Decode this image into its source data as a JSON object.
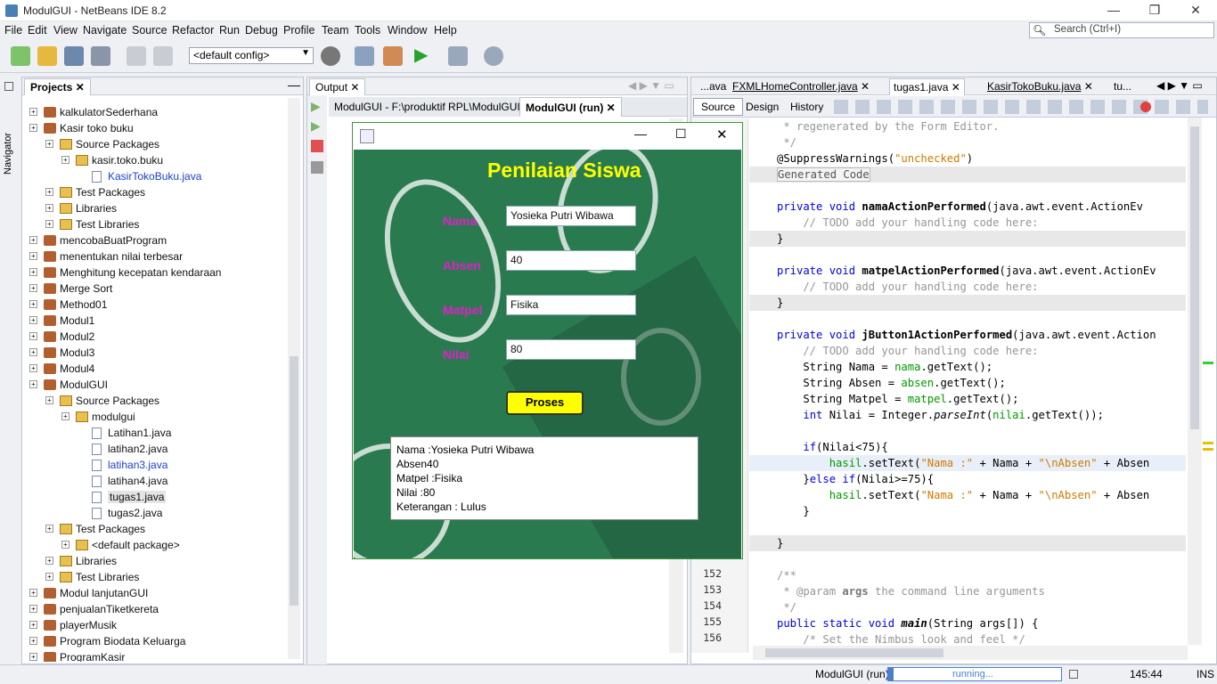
{
  "window": {
    "title": "ModulGUI - NetBeans IDE 8.2"
  },
  "menu": [
    "File",
    "Edit",
    "View",
    "Navigate",
    "Source",
    "Refactor",
    "Run",
    "Debug",
    "Profile",
    "Team",
    "Tools",
    "Window",
    "Help"
  ],
  "search": {
    "placeholder": "Search (Ctrl+I)"
  },
  "toolbar": {
    "config": "<default config>"
  },
  "navigator": {
    "label": "Navigator"
  },
  "projects": {
    "tab": "Projects",
    "items": [
      {
        "label": "kalkulatorSederhana",
        "type": "project",
        "indent": 0
      },
      {
        "label": "Kasir toko buku",
        "type": "project",
        "indent": 0
      },
      {
        "label": "Source Packages",
        "type": "folder",
        "indent": 1
      },
      {
        "label": "kasir.toko.buku",
        "type": "package",
        "indent": 2
      },
      {
        "label": "KasirTokoBuku.java",
        "type": "file",
        "indent": 3,
        "link": true
      },
      {
        "label": "Test Packages",
        "type": "folder",
        "indent": 1
      },
      {
        "label": "Libraries",
        "type": "folder",
        "indent": 1
      },
      {
        "label": "Test Libraries",
        "type": "folder",
        "indent": 1
      },
      {
        "label": "mencobaBuatProgram",
        "type": "project",
        "indent": 0
      },
      {
        "label": "menentukan nilai terbesar",
        "type": "project",
        "indent": 0
      },
      {
        "label": "Menghitung kecepatan kendaraan",
        "type": "project",
        "indent": 0
      },
      {
        "label": "Merge Sort",
        "type": "project",
        "indent": 0
      },
      {
        "label": "Method01",
        "type": "project",
        "indent": 0
      },
      {
        "label": "Modul1",
        "type": "project",
        "indent": 0
      },
      {
        "label": "Modul2",
        "type": "project",
        "indent": 0
      },
      {
        "label": "Modul3",
        "type": "project",
        "indent": 0
      },
      {
        "label": "Modul4",
        "type": "project",
        "indent": 0
      },
      {
        "label": "ModulGUI",
        "type": "project",
        "indent": 0
      },
      {
        "label": "Source Packages",
        "type": "folder",
        "indent": 1
      },
      {
        "label": "modulgui",
        "type": "package",
        "indent": 2
      },
      {
        "label": "Latihan1.java",
        "type": "file",
        "indent": 3
      },
      {
        "label": "latihan2.java",
        "type": "file",
        "indent": 3
      },
      {
        "label": "latihan3.java",
        "type": "file",
        "indent": 3,
        "link": true
      },
      {
        "label": "latihan4.java",
        "type": "file",
        "indent": 3
      },
      {
        "label": "tugas1.java",
        "type": "file",
        "indent": 3,
        "selected": true
      },
      {
        "label": "tugas2.java",
        "type": "file",
        "indent": 3
      },
      {
        "label": "Test Packages",
        "type": "folder",
        "indent": 1
      },
      {
        "label": "<default package>",
        "type": "package",
        "indent": 2
      },
      {
        "label": "Libraries",
        "type": "folder",
        "indent": 1
      },
      {
        "label": "Test Libraries",
        "type": "folder",
        "indent": 1
      },
      {
        "label": "Modul lanjutanGUI",
        "type": "project",
        "indent": 0
      },
      {
        "label": "penjualanTiketkereta",
        "type": "project",
        "indent": 0
      },
      {
        "label": "playerMusik",
        "type": "project",
        "indent": 0
      },
      {
        "label": "Program Biodata Keluarga",
        "type": "project",
        "indent": 0
      },
      {
        "label": "ProgramKasir",
        "type": "project",
        "indent": 0
      }
    ]
  },
  "output": {
    "tab": "Output",
    "subtabs": [
      "ModulGUI - F:\\produktif RPL\\ModulGUI",
      "ModulGUI (run)"
    ]
  },
  "editor": {
    "tabs": [
      "...ava",
      "FXMLHomeController.java",
      "tugas1.java",
      "KasirTokoBuku.java",
      "tu..."
    ],
    "source_btn": "Source",
    "design_btn": "Design",
    "history_btn": "History"
  },
  "code": [
    {
      "ln": "",
      "html": "<span class='cm'> * regenerated by the Form Editor.</span>"
    },
    {
      "ln": "",
      "html": "<span class='cm'> */</span>"
    },
    {
      "ln": "",
      "html": "@SuppressWarnings(<span class='st'>\"unchecked\"</span>)"
    },
    {
      "ln": "",
      "html": "<span style='border:1px solid #bbb;background:#f4f4f4;color:#555'>Generated Code</span>"
    },
    {
      "ln": "",
      "html": ""
    },
    {
      "ln": "",
      "html": "<span class='kw'>private void</span> <b>namaActionPerformed</b>(java.awt.event.ActionEv"
    },
    {
      "ln": "",
      "html": "<span class='cm'>    // TODO add your handling code here:</span>"
    },
    {
      "ln": "",
      "html": "}"
    },
    {
      "ln": "",
      "html": ""
    },
    {
      "ln": "",
      "html": "<span class='kw'>private void</span> <b>matpelActionPerformed</b>(java.awt.event.ActionEv"
    },
    {
      "ln": "",
      "html": "<span class='cm'>    // TODO add your handling code here:</span>"
    },
    {
      "ln": "",
      "html": "}"
    },
    {
      "ln": "",
      "html": ""
    },
    {
      "ln": "",
      "html": "<span class='kw'>private void</span> <b>jButton1ActionPerformed</b>(java.awt.event.Action"
    },
    {
      "ln": "",
      "html": "<span class='cm'>    // TODO add your handling code here:</span>"
    },
    {
      "ln": "",
      "html": "    String Nama = <span class='fld'>nama</span>.getText();"
    },
    {
      "ln": "",
      "html": "    String Absen = <span class='fld'>absen</span>.getText();"
    },
    {
      "ln": "",
      "html": "    String Matpel = <span class='fld'>matpel</span>.getText();"
    },
    {
      "ln": "",
      "html": "    <span class='kw'>int</span> Nilai = Integer.<i>parseInt</i>(<span class='fld'>nilai</span>.getText());"
    },
    {
      "ln": "",
      "html": ""
    },
    {
      "ln": "",
      "html": "    <span class='kw'>if</span>(Nilai&lt;75){"
    },
    {
      "ln": "",
      "html": "        <span class='fld'>hasil</span>.setText(<span class='st'>\"Nama :\"</span> + Nama + <span class='st'>\"\\nAbsen\"</span> + Absen"
    },
    {
      "ln": "",
      "html": "    }<span class='kw'>else if</span>(Nilai&gt;=75){"
    },
    {
      "ln": "",
      "html": "        <span class='fld'>hasil</span>.setText(<span class='st'>\"Nama :\"</span> + Nama + <span class='st'>\"\\nAbsen\"</span> + Absen"
    },
    {
      "ln": "",
      "html": "    }"
    },
    {
      "ln": "",
      "html": ""
    },
    {
      "ln": "",
      "html": "}"
    },
    {
      "ln": "",
      "html": ""
    },
    {
      "ln": "152",
      "html": "<span class='cm'>/**</span>"
    },
    {
      "ln": "153",
      "html": "<span class='cm'> * @param <b style='color:#777'>args</b> the command line arguments</span>"
    },
    {
      "ln": "154",
      "html": "<span class='cm'> */</span>"
    },
    {
      "ln": "155",
      "html": "<span class='kw'>public static void</span> <b><i>main</i></b>(String args[]) {"
    },
    {
      "ln": "156",
      "html": "<span class='cm'>    /* Set the Nimbus look and feel */</span>"
    }
  ],
  "app": {
    "heading": "Penilaian Siswa",
    "labels": {
      "nama": "Nama",
      "absen": "Absen",
      "matpel": "Matpel",
      "nilai": "Nilai"
    },
    "values": {
      "nama": "Yosieka Putri Wibawa",
      "absen": "40",
      "matpel": "Fisika",
      "nilai": "80"
    },
    "button": "Proses",
    "result": [
      "Nama :Yosieka Putri Wibawa",
      "Absen40",
      "Matpel :Fisika",
      "Nilai :80",
      "Keterangan : Lulus"
    ]
  },
  "status": {
    "project": "ModulGUI (run)",
    "progress": "running...",
    "position": "145:44",
    "mode": "INS"
  },
  "colors": {
    "accent": "#ffff00",
    "heading": "#ffff00",
    "label": "#e020c8",
    "app_bg": "#2a7a50"
  }
}
